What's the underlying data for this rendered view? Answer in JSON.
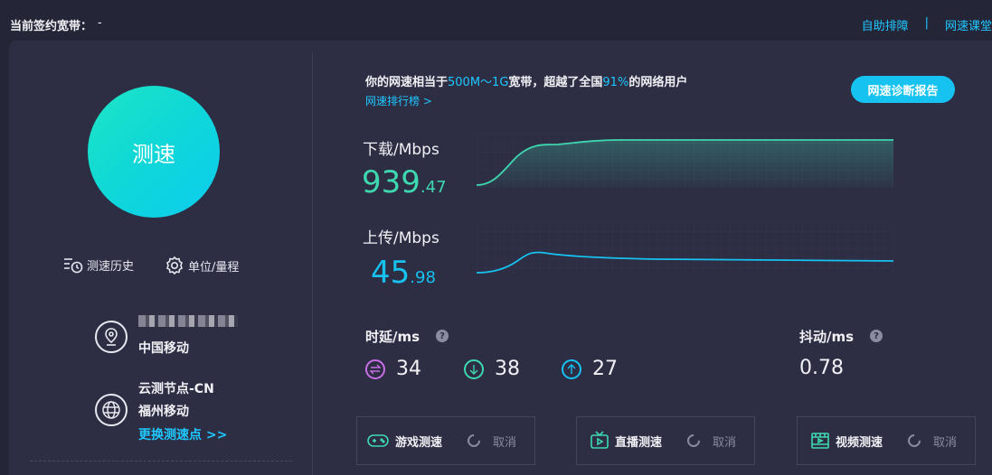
{
  "header": {
    "bandwidth_label": "当前签约宽带：",
    "bandwidth_value": "-",
    "links": [
      "自助排障",
      "网速课堂"
    ],
    "separator": "|"
  },
  "left": {
    "speed_test_button": "测速",
    "tools": [
      {
        "label": "测速历史",
        "icon": "history-icon"
      },
      {
        "label": "单位/量程",
        "icon": "gear-icon"
      }
    ],
    "location": {
      "isp": "中国移动",
      "icon": "location-pin-icon"
    },
    "node": {
      "name": "云测节点-CN",
      "isp": "福州移动",
      "icon": "globe-icon"
    },
    "change_node_link": "更换测速点 >>"
  },
  "summary": {
    "prefix": "你的网速相当于",
    "range": "500M～1G",
    "mid": "宽带，超越了全国",
    "percent": "91%",
    "suffix": "的网络用户",
    "rank_link": "网速排行榜 >",
    "report_button": "网速诊断报告"
  },
  "download": {
    "label": "下载/Mbps",
    "value_int": "939",
    "value_dec": ".47",
    "color": "#3ed8b0"
  },
  "upload": {
    "label": "上传/Mbps",
    "value_int": "45",
    "value_dec": ".98",
    "color": "#16c2f0"
  },
  "latency": {
    "label": "时延/ms",
    "values": [
      {
        "icon": "swap-icon",
        "value": "34",
        "color": "#c86ee6"
      },
      {
        "icon": "download-arrow-icon",
        "value": "38",
        "color": "#3ed8b0"
      },
      {
        "icon": "upload-arrow-icon",
        "value": "27",
        "color": "#16c2f0"
      }
    ]
  },
  "jitter": {
    "label": "抖动/ms",
    "value": "0.78"
  },
  "cards": [
    {
      "label": "游戏测速",
      "icon": "gamepad-icon",
      "cancel": "取消"
    },
    {
      "label": "直播测速",
      "icon": "tv-icon",
      "cancel": "取消"
    },
    {
      "label": "视频测速",
      "icon": "film-icon",
      "cancel": "取消"
    }
  ],
  "colors": {
    "accent": "#16c2f0",
    "teal": "#3ed8b0",
    "bg": "#252538",
    "panel": "#2d2d44"
  }
}
